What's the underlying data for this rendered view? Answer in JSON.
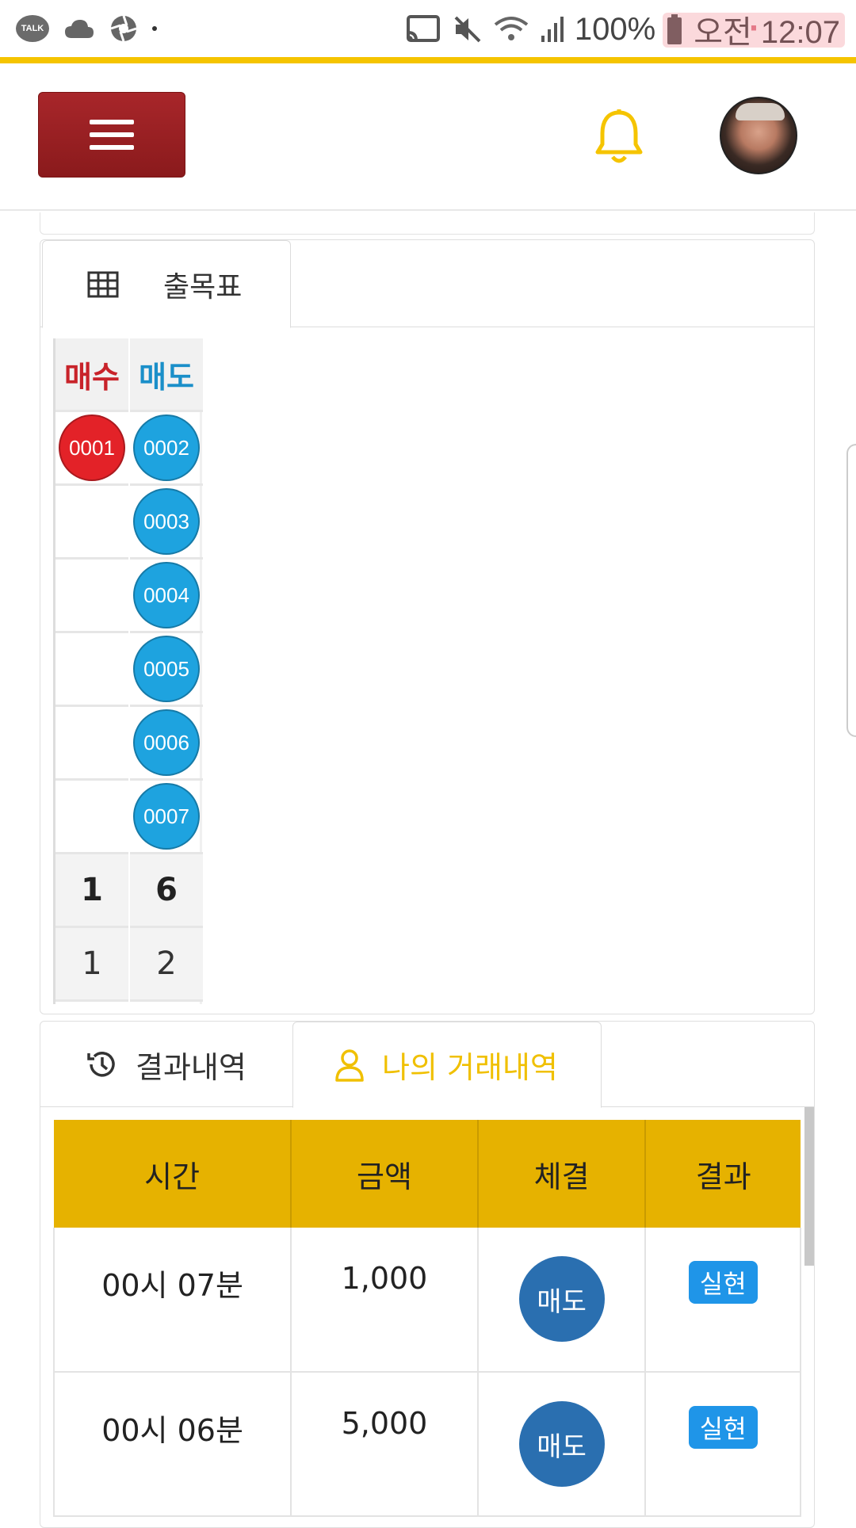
{
  "status_bar": {
    "talk_label": "TALK",
    "battery": "100%",
    "time": "오전 12:07"
  },
  "header": {
    "menu_icon": "hamburger-icon",
    "bell_icon": "bell-icon",
    "accent_color": "#f5c400"
  },
  "chart_panel": {
    "tab_label": "출목표",
    "tab_icon": "table-grid-icon",
    "columns": [
      {
        "header": "매수",
        "header_color": "#c8232a",
        "balls": [
          "0001"
        ],
        "ball_color": "#e32228",
        "total": "1",
        "count": "1"
      },
      {
        "header": "매도",
        "header_color": "#1a8fc9",
        "balls": [
          "0002",
          "0003",
          "0004",
          "0005",
          "0006",
          "0007"
        ],
        "ball_color": "#1ea3df",
        "total": "6",
        "count": "2"
      }
    ]
  },
  "history_panel": {
    "tab_results": "결과내역",
    "tab_results_icon": "history-icon",
    "tab_my_trades": "나의 거래내역",
    "tab_my_trades_icon": "user-icon",
    "table": {
      "headers": [
        "시간",
        "금액",
        "체결",
        "결과"
      ],
      "rows": [
        {
          "time": "00시 07분",
          "amount": "1,000",
          "action": "매도",
          "result": "실현"
        },
        {
          "time": "00시 06분",
          "amount": "5,000",
          "action": "매도",
          "result": "실현"
        }
      ]
    }
  }
}
